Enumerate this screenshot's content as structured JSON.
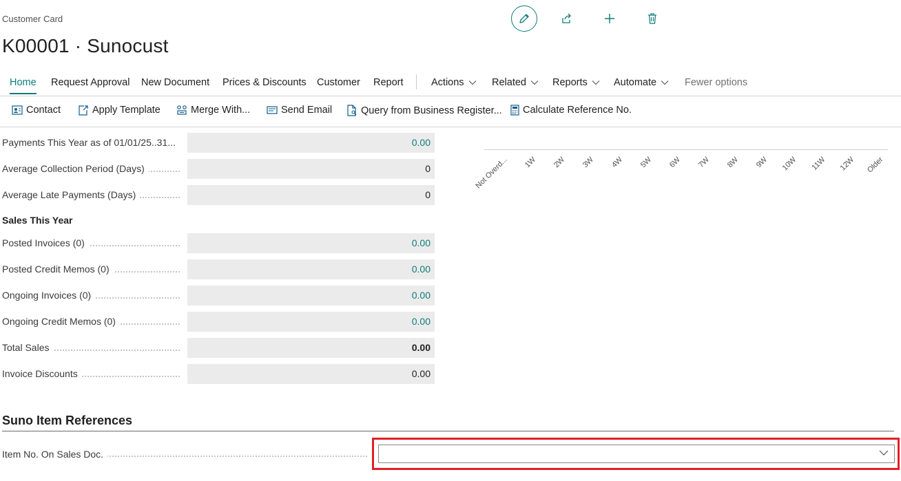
{
  "header": {
    "breadcrumb": "Customer Card",
    "title": "K00001 · Sunocust"
  },
  "menu": {
    "items": [
      "Home",
      "Request Approval",
      "New Document",
      "Prices & Discounts",
      "Customer",
      "Report"
    ],
    "dropdowns": [
      "Actions",
      "Related",
      "Reports",
      "Automate"
    ],
    "fewer": "Fewer options"
  },
  "toolbar": {
    "items": [
      "Contact",
      "Apply Template",
      "Merge With...",
      "Send Email",
      "Query from Business Register...",
      "Calculate Reference No."
    ]
  },
  "fields": {
    "payments": {
      "label": "Payments This Year as of 01/01/25..31...",
      "value": "0.00"
    },
    "avg_collection": {
      "label": "Average Collection Period (Days)",
      "value": "0"
    },
    "avg_late": {
      "label": "Average Late Payments (Days)",
      "value": "0"
    }
  },
  "sales_group": {
    "title": "Sales This Year",
    "rows": [
      {
        "label": "Posted Invoices (0)",
        "value": "0.00"
      },
      {
        "label": "Posted Credit Memos (0)",
        "value": "0.00"
      },
      {
        "label": "Ongoing Invoices (0)",
        "value": "0.00"
      },
      {
        "label": "Ongoing Credit Memos (0)",
        "value": "0.00"
      },
      {
        "label": "Total Sales",
        "value": "0.00"
      },
      {
        "label": "Invoice Discounts",
        "value": "0.00"
      }
    ]
  },
  "aging_chart": {
    "ticks": [
      "Not Overd...",
      "1W",
      "2W",
      "3W",
      "4W",
      "5W",
      "6W",
      "7W",
      "8W",
      "9W",
      "10W",
      "11W",
      "12W",
      "Older"
    ]
  },
  "section": {
    "title": "Suno Item References",
    "field_label": "Item No. On Sales Doc.",
    "field_value": ""
  },
  "colors": {
    "accent": "#0f7b7c",
    "highlight": "#e0202a"
  }
}
